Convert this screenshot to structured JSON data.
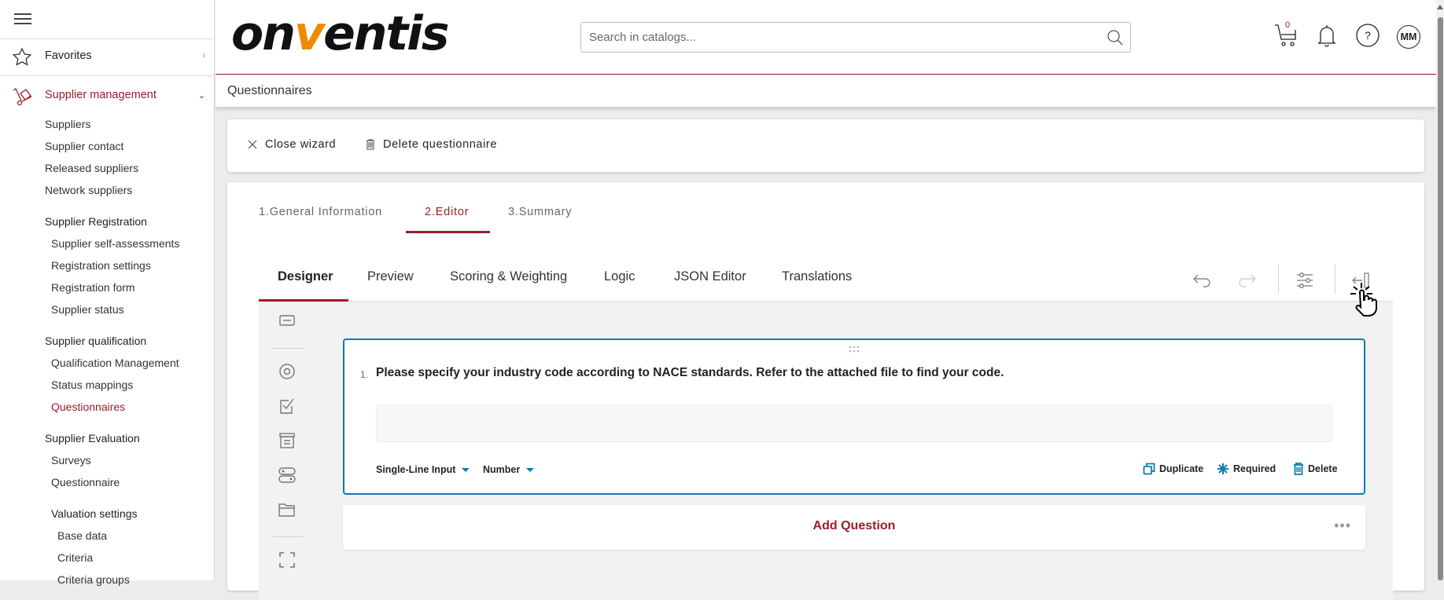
{
  "sidebar": {
    "favorites": "Favorites",
    "section": "Supplier management",
    "items": [
      {
        "label": "Suppliers"
      },
      {
        "label": "Supplier contact"
      },
      {
        "label": "Released suppliers"
      },
      {
        "label": "Network suppliers"
      }
    ],
    "groups": [
      {
        "title": "Supplier Registration",
        "items": [
          "Supplier self-assessments",
          "Registration settings",
          "Registration form",
          "Supplier status"
        ]
      },
      {
        "title": "Supplier qualification",
        "items": [
          "Qualification Management",
          "Status mappings",
          "Questionnaires"
        ]
      },
      {
        "title": "Supplier Evaluation",
        "items": [
          "Surveys",
          "Questionnaire"
        ]
      },
      {
        "title": "Valuation settings",
        "items": [
          "Base data",
          "Criteria",
          "Criteria groups"
        ]
      }
    ],
    "active_item": "Questionnaires"
  },
  "header": {
    "logo_pre": "on",
    "logo_v": "v",
    "logo_post": "entis",
    "search_placeholder": "Search in catalogs...",
    "cart_count": "0",
    "avatar_initials": "MM"
  },
  "breadcrumb": "Questionnaires",
  "wizard_toolbar": {
    "close": "Close wizard",
    "delete": "Delete questionnaire"
  },
  "steps": [
    {
      "label": "1.General Information",
      "active": false
    },
    {
      "label": "2.Editor",
      "active": true
    },
    {
      "label": "3.Summary",
      "active": false
    }
  ],
  "editor_tabs": [
    {
      "label": "Designer",
      "active": true
    },
    {
      "label": "Preview"
    },
    {
      "label": "Scoring & Weighting"
    },
    {
      "label": "Logic"
    },
    {
      "label": "JSON Editor"
    },
    {
      "label": "Translations"
    }
  ],
  "question": {
    "number": "1.",
    "text": "Please specify your industry code according to NACE standards. Refer to the attached file to find your code.",
    "input_type": "Single-Line Input",
    "value_type": "Number",
    "actions": {
      "duplicate": "Duplicate",
      "required": "Required",
      "delete": "Delete"
    }
  },
  "add_question": "Add Question",
  "colors": {
    "brand": "#9b1c2c",
    "accent": "#0a7bb3",
    "logo_orange": "#f08a00"
  }
}
